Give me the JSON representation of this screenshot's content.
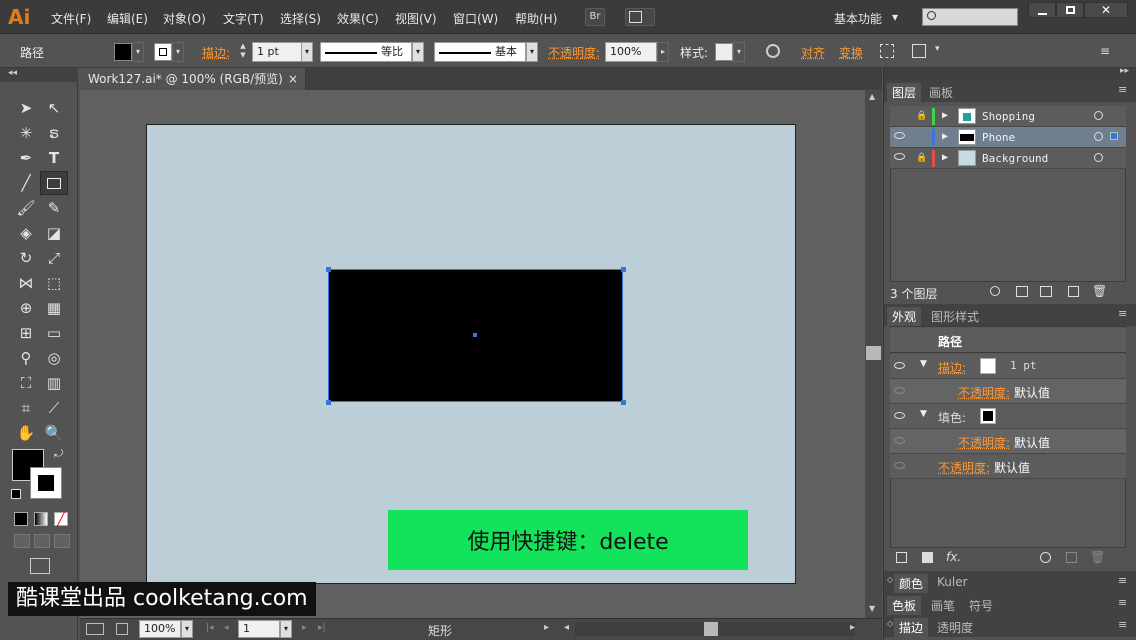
{
  "app": {
    "logo": "Ai"
  },
  "menu": [
    {
      "label": "文件(F)"
    },
    {
      "label": "编辑(E)"
    },
    {
      "label": "对象(O)"
    },
    {
      "label": "文字(T)"
    },
    {
      "label": "选择(S)"
    },
    {
      "label": "效果(C)"
    },
    {
      "label": "视图(V)"
    },
    {
      "label": "窗口(W)"
    },
    {
      "label": "帮助(H)"
    }
  ],
  "menubar": {
    "bridge": "Br",
    "workspace": "基本功能",
    "workspace_arrow": "▾"
  },
  "control": {
    "object_type": "路径",
    "stroke_label": "描边:",
    "stroke_weight": "1 pt",
    "profile1": "等比",
    "profile2": "基本",
    "opacity_label": "不透明度:",
    "opacity_value": "100%",
    "style_label": "样式:",
    "align_label": "对齐",
    "transform_label": "变换"
  },
  "document": {
    "tab_title": "Work127.ai* @ 100% (RGB/预览)",
    "close": "×"
  },
  "banner": {
    "text": "使用快捷键：delete"
  },
  "watermark": {
    "text": "酷课堂出品 coolketang.com"
  },
  "status": {
    "zoom": "100%",
    "page": "1",
    "tool": "矩形"
  },
  "layers_panel": {
    "tabs": [
      "图层",
      "画板"
    ],
    "layers": [
      {
        "name": "Shopping",
        "color": "#3ed34a",
        "locked": true
      },
      {
        "name": "Phone",
        "color": "#3b73e0",
        "locked": false
      },
      {
        "name": "Background",
        "color": "#e05050",
        "locked": true
      }
    ],
    "count_label": "3 个图层"
  },
  "appearance_panel": {
    "tabs": [
      "外观",
      "图形样式"
    ],
    "title": "路径",
    "rows": [
      {
        "label": "描边:",
        "value": "1 pt"
      },
      {
        "label": "不透明度:",
        "value": "默认值"
      },
      {
        "label": "填色:",
        "value": ""
      },
      {
        "label": "不透明度:",
        "value": "默认值"
      },
      {
        "label": "不透明度:",
        "value": "默认值"
      }
    ],
    "fx": "fx."
  },
  "collapsed_panels": [
    {
      "tabs": [
        "颜色",
        "Kuler"
      ]
    },
    {
      "tabs": [
        "色板",
        "画笔",
        "符号"
      ]
    },
    {
      "tabs": [
        "描边",
        "透明度"
      ]
    }
  ]
}
